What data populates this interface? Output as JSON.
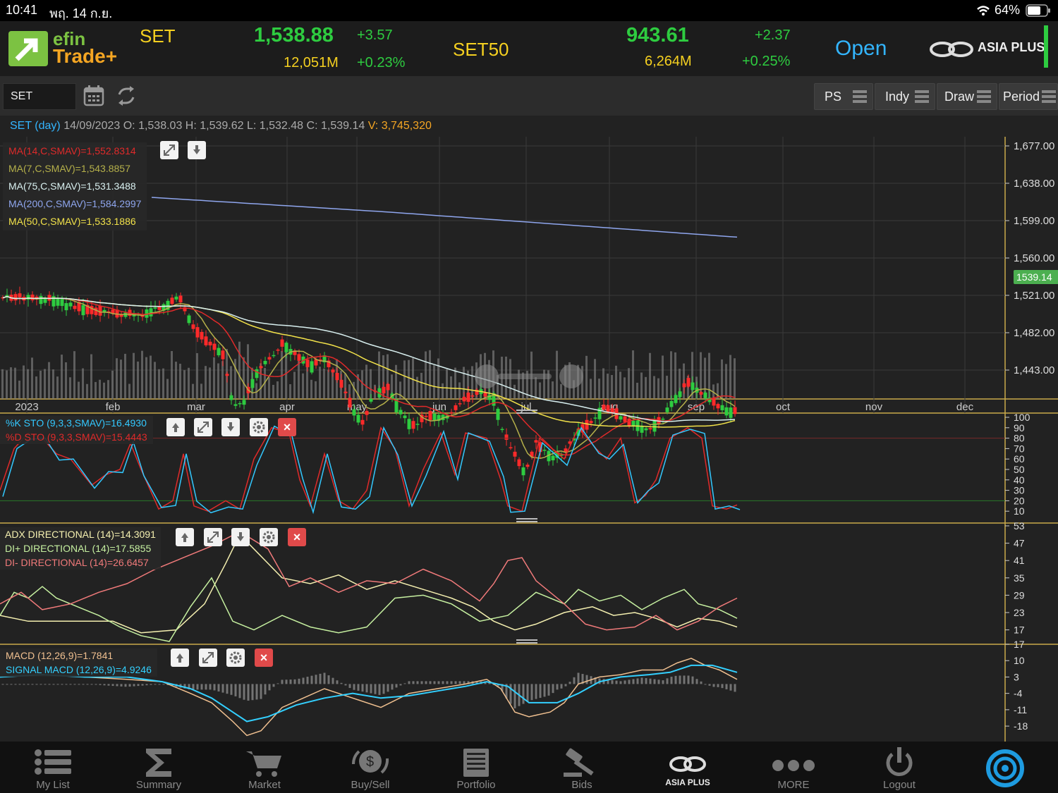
{
  "status_bar": {
    "time": "10:41",
    "date": "พฤ. 14 ก.ย.",
    "battery": "64%"
  },
  "header": {
    "logo_top": "efin",
    "logo_bottom": "Trade+",
    "set": {
      "name": "SET",
      "index": "1,538.88",
      "change": "+3.57",
      "volume": "12,051M",
      "change_pct": "+0.23%"
    },
    "set50": {
      "name": "SET50",
      "index": "943.61",
      "change": "+2.37",
      "volume": "6,264M",
      "change_pct": "+0.25%"
    },
    "market_status": "Open",
    "broker": "ASIA PLUS",
    "colors": {
      "up": "#2ecc40",
      "yellow": "#f5d020",
      "blue": "#33b5ff"
    }
  },
  "toolbar": {
    "symbol": "SET",
    "buttons": [
      {
        "label": "PS"
      },
      {
        "label": "Indy"
      },
      {
        "label": "Draw"
      },
      {
        "label": "Period"
      }
    ]
  },
  "info_line": {
    "symbol": "SET (day)",
    "date": "14/09/2023",
    "o_label": "O:",
    "o": "1,538.03",
    "h_label": "H:",
    "h": "1,539.62",
    "l_label": "L:",
    "l": "1,532.48",
    "c_label": "C:",
    "c": "1,539.14",
    "v_label": "V:",
    "v": "3,745,320"
  },
  "price_panel": {
    "legend": [
      {
        "text": "MA(14,C,SMAV)=1,552.8314",
        "color": "#e02a2a"
      },
      {
        "text": "MA(7,C,SMAV)=1,543.8857",
        "color": "#b5b04a"
      },
      {
        "text": "MA(75,C,SMAV)=1,531.3488",
        "color": "#d9f0f0"
      },
      {
        "text": "MA(200,C,SMAV)=1,584.2997",
        "color": "#8fa6ee"
      },
      {
        "text": "MA(50,C,SMAV)=1,533.1886",
        "color": "#f2e24a"
      }
    ],
    "y_ticks": [
      "1,677.00",
      "1,638.00",
      "1,599.00",
      "1,560.00",
      "1,521.00",
      "1,482.00",
      "1,443.00"
    ],
    "last_price": "1539.14",
    "x_ticks": [
      "2023",
      "feb",
      "mar",
      "apr",
      "may",
      "jun",
      "jul",
      "aug",
      "sep",
      "oct",
      "nov",
      "dec"
    ]
  },
  "sto_panel": {
    "legend": [
      {
        "text": "%K STO (9,3,3,SMAV)=16.4930",
        "color": "#33c8ff"
      },
      {
        "text": "%D STO (9,3,3,SMAV)=15.4443",
        "color": "#e02a2a"
      }
    ],
    "y_ticks": [
      "100",
      "90",
      "80",
      "70",
      "60",
      "50",
      "40",
      "30",
      "20",
      "10"
    ]
  },
  "adx_panel": {
    "legend": [
      {
        "text": "ADX DIRECTIONAL (14)=14.3091",
        "color": "#f5f0b0"
      },
      {
        "text": "DI+ DIRECTIONAL (14)=17.5855",
        "color": "#c6f0a0"
      },
      {
        "text": "DI- DIRECTIONAL (14)=26.6457",
        "color": "#f07a7a"
      }
    ],
    "y_ticks": [
      "53",
      "47",
      "41",
      "35",
      "29",
      "23",
      "17"
    ]
  },
  "macd_panel": {
    "legend": [
      {
        "text": "MACD (12,26,9)=1.7841",
        "color": "#f0c090"
      },
      {
        "text": "SIGNAL MACD (12,26,9)=4.9246",
        "color": "#33d0ff"
      }
    ],
    "y_ticks": [
      "17",
      "10",
      "3",
      "-4",
      "-11",
      "-18"
    ]
  },
  "tab_bar": {
    "items": [
      {
        "label": "My List",
        "icon": "list-icon"
      },
      {
        "label": "Summary",
        "icon": "sigma-icon"
      },
      {
        "label": "Market",
        "icon": "cart-icon"
      },
      {
        "label": "Buy/Sell",
        "icon": "buysell-icon"
      },
      {
        "label": "Portfolio",
        "icon": "portfolio-icon"
      },
      {
        "label": "Bids",
        "icon": "gavel-icon"
      },
      {
        "label": "ASIA PLUS",
        "icon": "asiaplus-logo-icon"
      },
      {
        "label": "MORE",
        "icon": "more-dots-icon"
      },
      {
        "label": "Logout",
        "icon": "power-icon"
      }
    ]
  }
}
